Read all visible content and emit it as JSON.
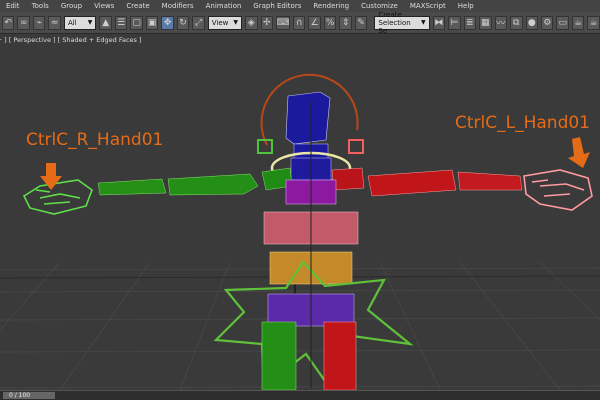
{
  "menu": [
    "Edit",
    "Tools",
    "Group",
    "Views",
    "Create",
    "Modifiers",
    "Animation",
    "Graph Editors",
    "Rendering",
    "Customize",
    "MAXScript",
    "Help"
  ],
  "toolbar": {
    "filter_value": "All",
    "refcoord_value": "View",
    "selection_set_placeholder": "Create Selection Se"
  },
  "viewport": {
    "label": "[ + ] [ Perspective ] [ Shaded + Edged Faces ]",
    "callouts": {
      "right_hand": "CtrlC_R_Hand01",
      "left_hand": "CtrlC_L_Hand01"
    }
  },
  "timeline": {
    "frame_readout": "0 / 100"
  },
  "colors": {
    "callout": "#e56b17",
    "right_side": "#2d9b1e",
    "left_side": "#c0161a",
    "spine": "#1f1a9c",
    "pelvis": "#5a2aa8",
    "selection_ring": "#e9e6a8",
    "control_star": "#5fc13a"
  }
}
